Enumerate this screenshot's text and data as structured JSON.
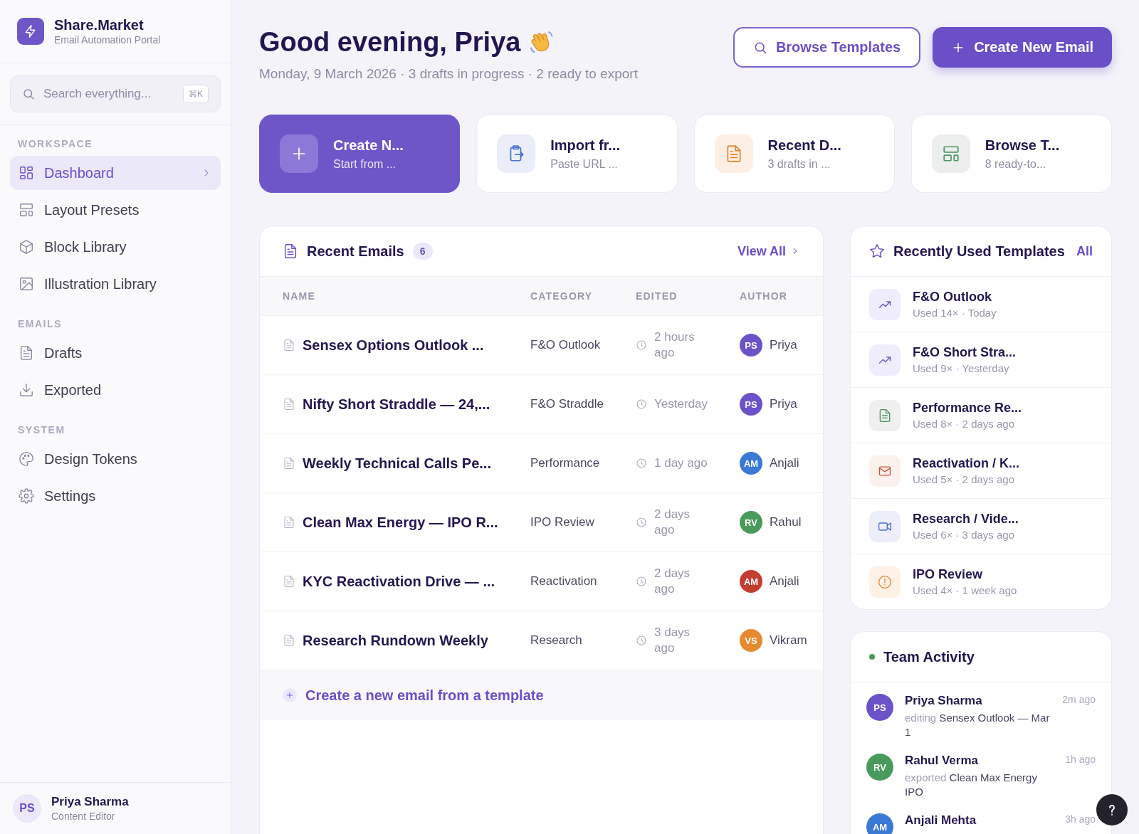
{
  "brand": {
    "name": "Share.Market",
    "tagline": "Email Automation Portal"
  },
  "search": {
    "placeholder": "Search everything...",
    "shortcut": "⌘K"
  },
  "sidebar": {
    "sections": [
      {
        "title": "WORKSPACE",
        "items": [
          {
            "label": "Dashboard",
            "kind": "grid",
            "selected": true
          },
          {
            "label": "Layout Presets",
            "kind": "layout",
            "selected": false
          },
          {
            "label": "Block Library",
            "kind": "cube",
            "selected": false
          },
          {
            "label": "Illustration Library",
            "kind": "image",
            "selected": false
          }
        ]
      },
      {
        "title": "EMAILS",
        "items": [
          {
            "label": "Drafts",
            "kind": "doc",
            "selected": false
          },
          {
            "label": "Exported",
            "kind": "download",
            "selected": false
          }
        ]
      },
      {
        "title": "SYSTEM",
        "items": [
          {
            "label": "Design Tokens",
            "kind": "palette",
            "selected": false
          },
          {
            "label": "Settings",
            "kind": "gear",
            "selected": false
          }
        ]
      }
    ]
  },
  "user": {
    "initials": "PS",
    "name": "Priya Sharma",
    "role": "Content Editor"
  },
  "header": {
    "greeting": "Good evening, Priya",
    "subtitle": "Monday, 9 March 2026 · 3 drafts in progress · 2 ready to export",
    "buttons": [
      {
        "label": "Browse Templates",
        "kind": "outline"
      },
      {
        "label": "Create New Email",
        "kind": "primary"
      }
    ]
  },
  "quick_actions": [
    {
      "title": "Create N...",
      "subtitle": "Start from ...",
      "kind": "create"
    },
    {
      "title": "Import fr...",
      "subtitle": "Paste URL ...",
      "kind": "import"
    },
    {
      "title": "Recent D...",
      "subtitle": "3 drafts in ...",
      "kind": "drafts"
    },
    {
      "title": "Browse T...",
      "subtitle": "8 ready-to...",
      "kind": "browse"
    }
  ],
  "recent_emails": {
    "title": "Recent Emails",
    "count": "6",
    "view_all": "View All",
    "columns": [
      "NAME",
      "CATEGORY",
      "EDITED",
      "AUTHOR"
    ],
    "rows": [
      {
        "name": "Sensex Options Outlook ...",
        "category": "F&O Outlook",
        "edited": "2 hours ago",
        "initials": "PS",
        "color": "#6c52c9",
        "author": "Priya"
      },
      {
        "name": "Nifty Short Straddle — 24,...",
        "category": "F&O Straddle",
        "edited": "Yesterday",
        "initials": "PS",
        "color": "#6c52c9",
        "author": "Priya"
      },
      {
        "name": "Weekly Technical Calls Pe...",
        "category": "Performance",
        "edited": "1 day ago",
        "initials": "AM",
        "color": "#3b79d6",
        "author": "Anjali"
      },
      {
        "name": "Clean Max Energy — IPO R...",
        "category": "IPO Review",
        "edited": "2 days ago",
        "initials": "RV",
        "color": "#4b9a5d",
        "author": "Rahul"
      },
      {
        "name": "KYC Reactivation Drive — ...",
        "category": "Reactivation",
        "edited": "2 days ago",
        "initials": "AM",
        "color": "#c23e31",
        "author": "Anjali"
      },
      {
        "name": "Research Rundown Weekly",
        "category": "Research",
        "edited": "3 days ago",
        "initials": "VS",
        "color": "#e58a2f",
        "author": "Vikram"
      }
    ],
    "footer_link": "Create a new email from a template"
  },
  "templates": {
    "title": "Recently Used Templates",
    "all_link": "All",
    "items": [
      {
        "name": "F&O Outlook",
        "meta": "Used 14× · Today",
        "kind": "trend"
      },
      {
        "name": "F&O Short Stra...",
        "meta": "Used 9× · Yesterday",
        "kind": "trend"
      },
      {
        "name": "Performance Re...",
        "meta": "Used 8× · 2 days ago",
        "kind": "sheet"
      },
      {
        "name": "Reactivation / K...",
        "meta": "Used 5× · 2 days ago",
        "kind": "mail"
      },
      {
        "name": "Research / Vide...",
        "meta": "Used 6× · 3 days ago",
        "kind": "video"
      },
      {
        "name": "IPO Review",
        "meta": "Used 4× · 1 week ago",
        "kind": "alert"
      }
    ]
  },
  "team_activity": {
    "title": "Team Activity",
    "items": [
      {
        "initials": "PS",
        "color": "#6c52c9",
        "name": "Priya Sharma",
        "verb": "editing",
        "target": "Sensex Outlook — Mar 1",
        "time": "2m ago"
      },
      {
        "initials": "RV",
        "color": "#4b9a5d",
        "name": "Rahul Verma",
        "verb": "exported",
        "target": "Clean Max Energy IPO",
        "time": "1h ago"
      },
      {
        "initials": "AM",
        "color": "#3b79d6",
        "name": "Anjali Mehta",
        "time": "3h ago"
      }
    ]
  }
}
